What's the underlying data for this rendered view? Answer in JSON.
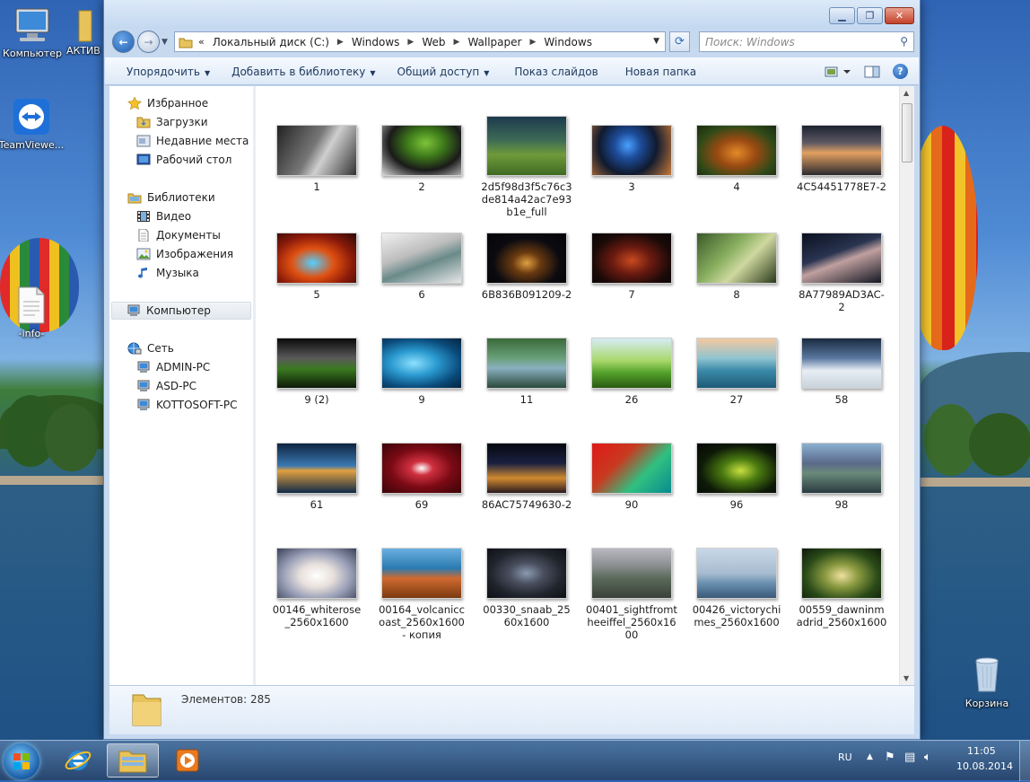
{
  "desktop": {
    "icons": [
      {
        "label": "Компьютер"
      },
      {
        "label": "АКТИВ"
      },
      {
        "label": "TeamViewe..."
      },
      {
        "label": "-info-"
      },
      {
        "label": "Корзина"
      }
    ]
  },
  "window": {
    "address": {
      "overflow": "«",
      "crumbs": [
        "Локальный диск (C:)",
        "Windows",
        "Web",
        "Wallpaper",
        "Windows"
      ]
    },
    "search": {
      "placeholder": "Поиск: Windows"
    },
    "toolbar": {
      "organize": "Упорядочить",
      "add_to_library": "Добавить в библиотеку",
      "share": "Общий доступ",
      "slideshow": "Показ слайдов",
      "new_folder": "Новая папка"
    },
    "nav": {
      "favorites": "Избранное",
      "downloads": "Загрузки",
      "recent": "Недавние места",
      "desktop": "Рабочий стол",
      "libraries": "Библиотеки",
      "video": "Видео",
      "documents": "Документы",
      "images": "Изображения",
      "music": "Музыка",
      "computer": "Компьютер",
      "network": "Сеть",
      "pcs": [
        "ADMIN-PC",
        "ASD-PC",
        "KOTTOSOFT-PC"
      ]
    },
    "files": [
      {
        "name": "1",
        "bg": "linear-gradient(120deg,#222 0%,#777 45%,#cfcfcf 60%,#333 100%)"
      },
      {
        "name": "2",
        "bg": "radial-gradient(ellipse at 55% 35%,#7ec43a 0%,#3d7a1a 30%,#1a1a1a 60%,#d8d8d8 100%)"
      },
      {
        "name": "2d5f98d3f5c76c3de814a42ac7e93b1e_full",
        "bg": "linear-gradient(180deg,#1d3a4e 0%,#3d6b55 40%,#6f9a3a 65%,#3f6a22 100%)"
      },
      {
        "name": "3",
        "bg": "radial-gradient(circle at 45% 40%,#4aa0ff 0%,#1d4c9a 25%,#101a2e 55%,#c87a3a 100%)"
      },
      {
        "name": "4",
        "bg": "radial-gradient(ellipse at 50% 55%,#e48a2a 0%,#9a4a12 35%,#2f4a18 70%,#1a2a10 100%)"
      },
      {
        "name": "4C54451778E7-2",
        "bg": "linear-gradient(180deg,#1c2230 0%,#5e5a64 35%,#e2a060 55%,#2b2a30 100%)"
      },
      {
        "name": "5",
        "bg": "radial-gradient(ellipse at 45% 60%,#52d0ff 0%,#e05010 35%,#8a1a0a 65%,#2a0a05 100%)"
      },
      {
        "name": "6",
        "bg": "linear-gradient(160deg,#f0f0f0 0%,#bdbdbd 40%,#6a8a8a 60%,#e6e6e6 100%)"
      },
      {
        "name": "6B836B091209-2",
        "bg": "radial-gradient(ellipse at 50% 60%,#e0a040 0%,#6a3a10 25%,#0a0a10 60%,#050508 100%)"
      },
      {
        "name": "7",
        "bg": "radial-gradient(ellipse at 50% 55%,#c84a20 0%,#6a1a10 35%,#1a0a08 70%,#0a0508 100%)"
      },
      {
        "name": "8",
        "bg": "linear-gradient(135deg,#3a5a2a 0%,#8ab060 40%,#cfd8a0 60%,#2a3a1a 100%)"
      },
      {
        "name": "8A77989AD3AC-2",
        "bg": "linear-gradient(160deg,#0a1020 0%,#2a3450 40%,#c0a0a0 55%,#141822 100%)"
      },
      {
        "name": "9 (2)",
        "bg": "linear-gradient(180deg,#0a0a0a 0%,#5a5a5a 40%,#3a7a20 62%,#0e1a08 100%)"
      },
      {
        "name": "9",
        "bg": "radial-gradient(ellipse at 40% 50%,#8ee0ff 0%,#2a9ad0 35%,#0a4a7a 70%,#06243e 100%)"
      },
      {
        "name": "11",
        "bg": "linear-gradient(180deg,#3a6a3a 0%,#6aa07a 40%,#8ab0c0 60%,#2a4a3a 100%)"
      },
      {
        "name": "26",
        "bg": "linear-gradient(180deg,#d6ecf5 0%,#a8d86a 45%,#52a02a 70%,#2a5a12 100%)"
      },
      {
        "name": "27",
        "bg": "linear-gradient(180deg,#f4c8a0 0%,#90c4d0 40%,#3a8aa8 65%,#1e5a78 100%)"
      },
      {
        "name": "58",
        "bg": "linear-gradient(180deg,#1a2a40 0%,#5a78a0 40%,#e8eef4 65%,#c8d2dc 100%)"
      },
      {
        "name": "61",
        "bg": "linear-gradient(180deg,#0e2440 0%,#3a78b0 45%,#e0a040 55%,#102a48 100%)"
      },
      {
        "name": "69",
        "bg": "radial-gradient(ellipse at 50% 50%,#ffffff 0%,#d03040 20%,#7a0a14 55%,#3a0408 100%)"
      },
      {
        "name": "86AC75749630-2",
        "bg": "linear-gradient(180deg,#050810 0%,#1a2040 40%,#d08a30 70%,#2a1a20 100%)"
      },
      {
        "name": "90",
        "bg": "linear-gradient(135deg,#e01818 0%,#c83a20 35%,#30c080 65%,#0a8a90 100%)"
      },
      {
        "name": "96",
        "bg": "radial-gradient(ellipse at 55% 55%,#c8e040 0%,#4a7a10 30%,#0e1a08 65%,#050805 100%)"
      },
      {
        "name": "98",
        "bg": "linear-gradient(180deg,#8ab0d0 0%,#5a6a8a 40%,#6a8a7a 60%,#2a3a40 100%)"
      },
      {
        "name": "00146_whiterose_2560x1600",
        "bg": "radial-gradient(ellipse at 50% 55%,#ffffff 0%,#e8e0dc 30%,#9aa0b8 60%,#3a4058 100%)"
      },
      {
        "name": "00164_volcaniccoast_2560x1600 - копия",
        "bg": "linear-gradient(180deg,#6ab0e0 0%,#2a7ab0 40%,#d06a30 60%,#7a3a10 100%)"
      },
      {
        "name": "00330_snaab_2560x1600",
        "bg": "radial-gradient(ellipse at 50% 50%,#8a9ab0 0%,#4a5060 30%,#20242c 65%,#0e1014 100%)"
      },
      {
        "name": "00401_sightfromtheeiffel_2560x1600",
        "bg": "linear-gradient(180deg,#b8b8c0 0%,#8a8e90 35%,#5a6a5a 60%,#3a4038 100%)"
      },
      {
        "name": "00426_victorychimes_2560x1600",
        "bg": "linear-gradient(180deg,#c8d8e8 0%,#a8bcd0 50%,#6a90b0 70%,#3a5a78 100%)"
      },
      {
        "name": "00559_dawninmadrid_2560x1600",
        "bg": "radial-gradient(ellipse at 50% 55%,#f0e0a0 0%,#8a9a40 30%,#2a4a18 65%,#0e1a08 100%)"
      }
    ],
    "status": {
      "count": "Элементов: 285"
    }
  },
  "taskbar": {
    "lang": "RU",
    "time": "11:05",
    "date": "10.08.2014"
  },
  "colors": {
    "accent": "#1f5eb0",
    "toolbar_text": "#1e3a5f",
    "window_frame": "#c6d9ef"
  }
}
